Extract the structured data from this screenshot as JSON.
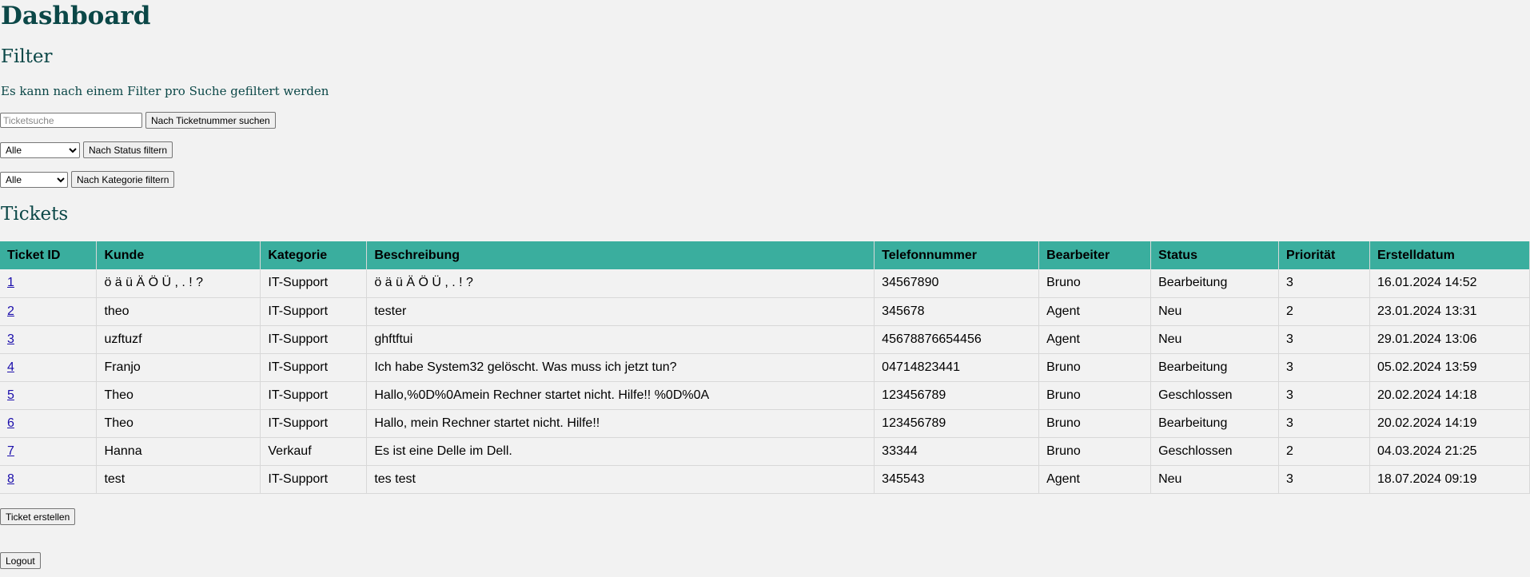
{
  "header": {
    "title": "Dashboard"
  },
  "filter": {
    "heading": "Filter",
    "note": "Es kann nach einem Filter pro Suche gefiltert werden",
    "search": {
      "placeholder": "Ticketsuche",
      "value": "",
      "button": "Nach Ticketnummer suchen"
    },
    "status": {
      "selected": "Alle",
      "button": "Nach Status filtern"
    },
    "category": {
      "selected": "Alle",
      "button": "Nach Kategorie filtern"
    }
  },
  "tickets": {
    "heading": "Tickets",
    "columns": [
      "Ticket ID",
      "Kunde",
      "Kategorie",
      "Beschreibung",
      "Telefonnummer",
      "Bearbeiter",
      "Status",
      "Priorität",
      "Erstelldatum"
    ],
    "rows": [
      [
        "1",
        "ö ä ü Ä Ö Ü , . ! ?",
        "IT-Support",
        "ö ä ü Ä Ö Ü , . ! ?",
        "34567890",
        "Bruno",
        "Bearbeitung",
        "3",
        "16.01.2024 14:52"
      ],
      [
        "2",
        "theo",
        "IT-Support",
        "tester",
        "345678",
        "Agent",
        "Neu",
        "2",
        "23.01.2024 13:31"
      ],
      [
        "3",
        "uzftuzf",
        "IT-Support",
        "ghftftui",
        "45678876654456",
        "Agent",
        "Neu",
        "3",
        "29.01.2024 13:06"
      ],
      [
        "4",
        "Franjo",
        "IT-Support",
        "Ich habe System32 gelöscht. Was muss ich jetzt tun?",
        "04714823441",
        "Bruno",
        "Bearbeitung",
        "3",
        "05.02.2024 13:59"
      ],
      [
        "5",
        "Theo",
        "IT-Support",
        "Hallo,%0D%0Amein Rechner startet nicht. Hilfe!! %0D%0A",
        "123456789",
        "Bruno",
        "Geschlossen",
        "3",
        "20.02.2024 14:18"
      ],
      [
        "6",
        "Theo",
        "IT-Support",
        "Hallo, mein Rechner startet nicht. Hilfe!!",
        "123456789",
        "Bruno",
        "Bearbeitung",
        "3",
        "20.02.2024 14:19"
      ],
      [
        "7",
        "Hanna",
        "Verkauf",
        "Es ist eine Delle im Dell.",
        "33344",
        "Bruno",
        "Geschlossen",
        "2",
        "04.03.2024 21:25"
      ],
      [
        "8",
        "test",
        "IT-Support",
        "tes test",
        "345543",
        "Agent",
        "Neu",
        "3",
        "18.07.2024 09:19"
      ]
    ]
  },
  "actions": {
    "create": "Ticket erstellen",
    "logout": "Logout"
  },
  "colors": {
    "header_bg": "#3aae9e",
    "heading_text": "#0b4747",
    "page_bg": "#f2f2f2",
    "link": "#1a0dab"
  }
}
